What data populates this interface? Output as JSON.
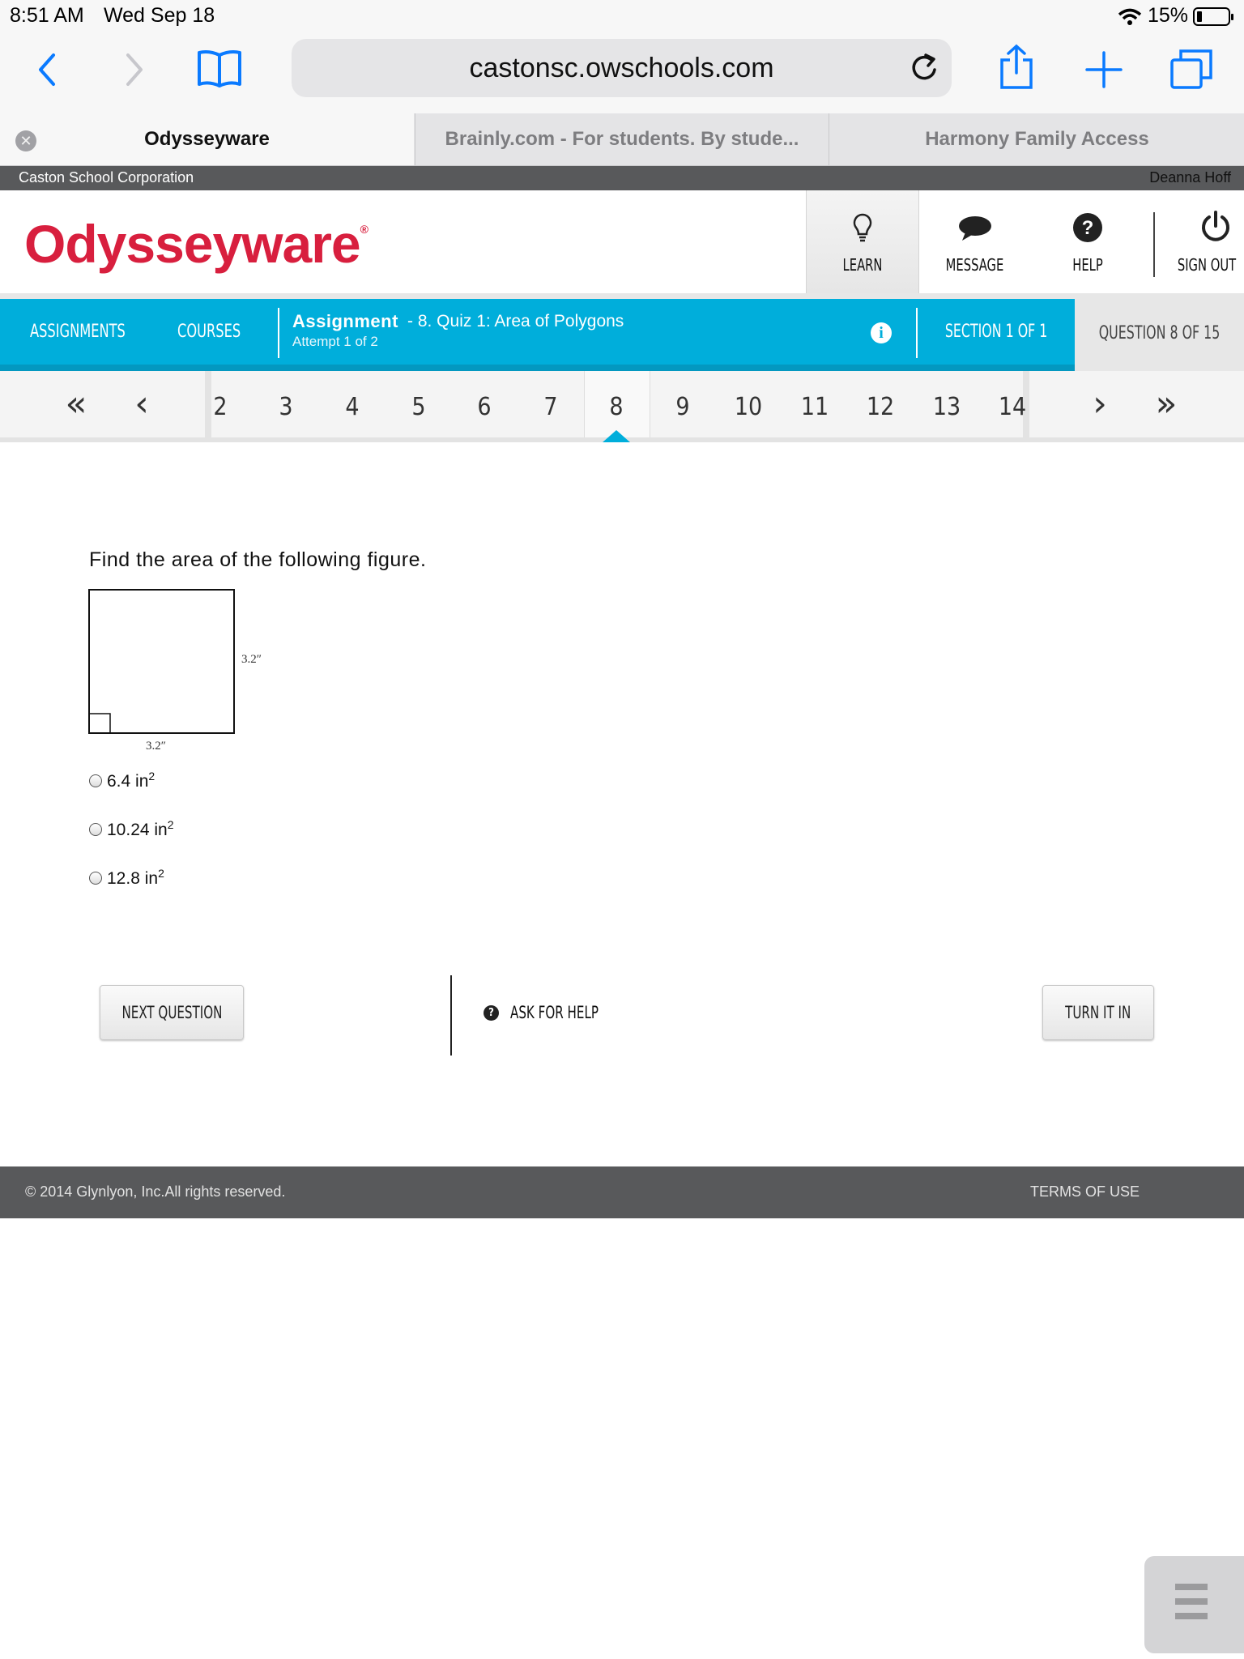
{
  "status": {
    "time": "8:51 AM",
    "date": "Wed Sep 18",
    "battery": "15%"
  },
  "browser": {
    "url": "castonsc.owschools.com",
    "tabs": [
      {
        "label": "Odysseyware"
      },
      {
        "label": "Brainly.com - For students. By stude..."
      },
      {
        "label": "Harmony Family Access"
      }
    ]
  },
  "school": {
    "name": "Caston School Corporation",
    "user": "Deanna Hoff"
  },
  "header": {
    "logo": "Odysseyware",
    "logo_mark": "®",
    "buttons": {
      "learn": "LEARN",
      "message": "MESSAGE",
      "help": "HELP",
      "signout": "SIGN OUT"
    }
  },
  "nav": {
    "assignments": "ASSIGNMENTS",
    "courses": "COURSES",
    "assignment_label": "Assignment",
    "assignment_name": "- 8. Quiz 1: Area of Polygons",
    "attempt": "Attempt 1 of 2",
    "section": "SECTION 1 OF 1",
    "question": "QUESTION 8 OF 15"
  },
  "pager": {
    "numbers": [
      "2",
      "3",
      "4",
      "5",
      "6",
      "7",
      "8",
      "9",
      "10",
      "11",
      "12",
      "13",
      "14"
    ],
    "current": "8"
  },
  "question": {
    "prompt": "Find the area of the following figure.",
    "side_right": "3.2″",
    "side_bottom": "3.2″",
    "options": [
      {
        "value": "6.4 in",
        "exp": "2"
      },
      {
        "value": "10.24 in",
        "exp": "2"
      },
      {
        "value": "12.8 in",
        "exp": "2"
      }
    ]
  },
  "actions": {
    "next": "NEXT QUESTION",
    "ask": "ASK FOR HELP",
    "turnin": "TURN IT IN"
  },
  "footer": {
    "copyright": "© 2014 Glynlyon, Inc.All rights reserved.",
    "terms": "TERMS OF USE"
  },
  "colors": {
    "brand_red": "#d81f3e",
    "nav_blue": "#00aedb",
    "dark_bar": "#58595b"
  }
}
